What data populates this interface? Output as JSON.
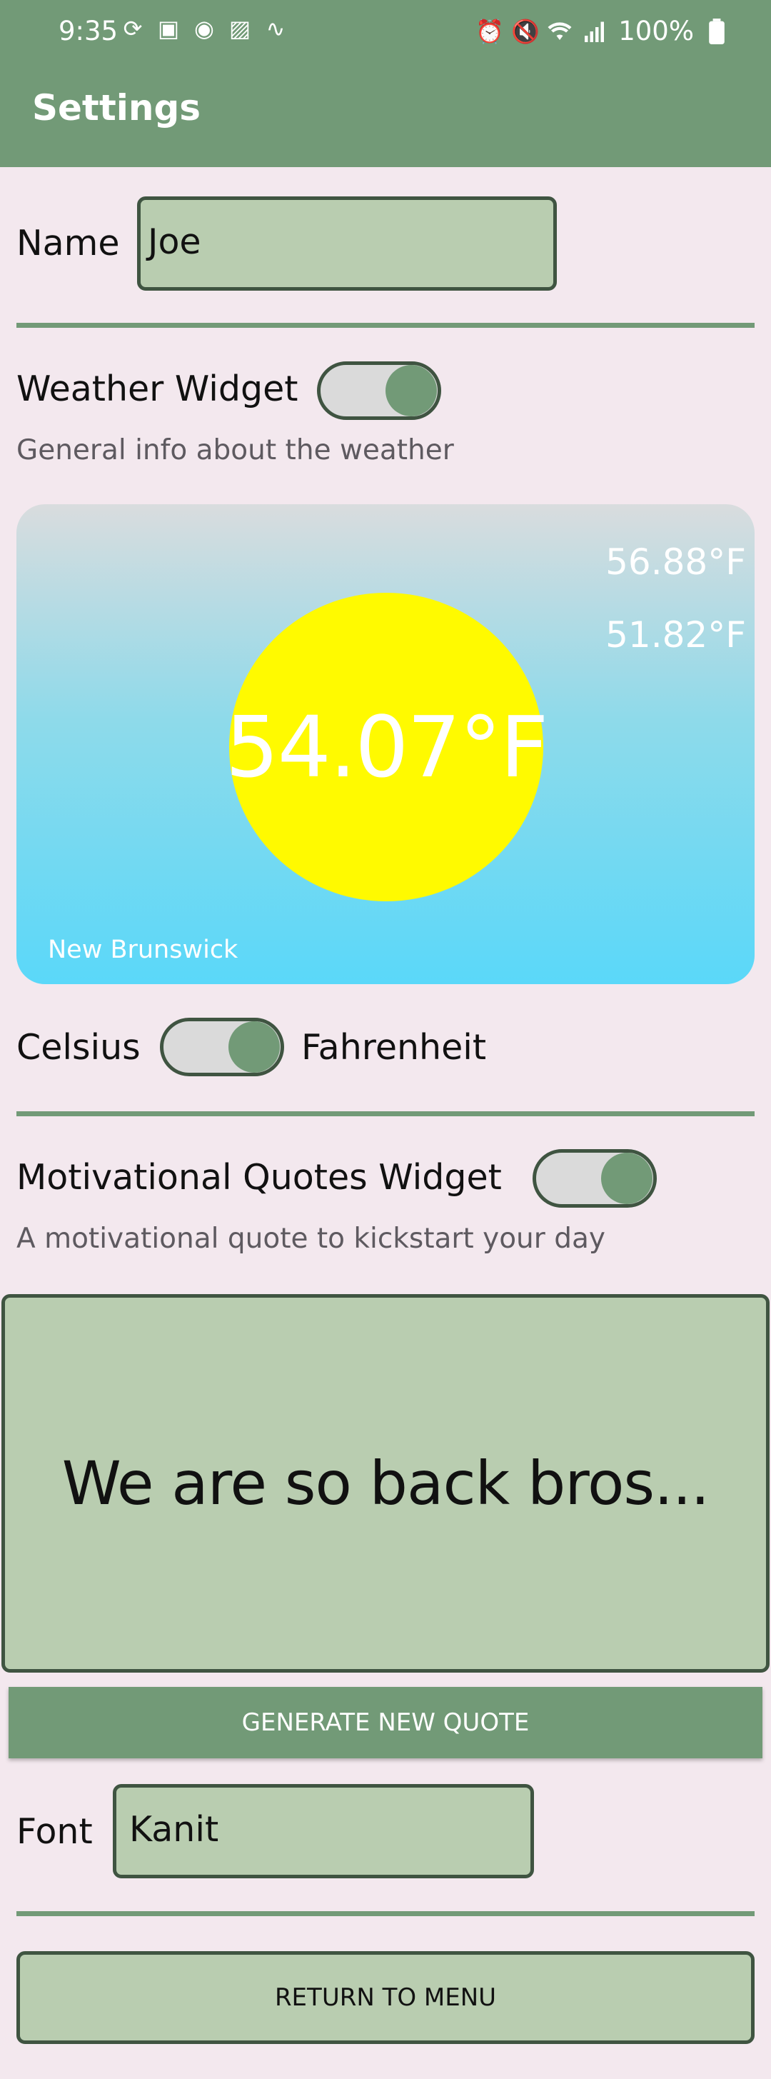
{
  "status_bar": {
    "time": "9:35",
    "battery": "100%",
    "left_icons": [
      "sync-icon",
      "voicemail-icon",
      "assistant-icon",
      "gallery-icon",
      "audio-wave-icon"
    ],
    "right_icons": [
      "alarm-icon",
      "mute-icon",
      "wifi-icon",
      "signal-icon",
      "battery-icon"
    ]
  },
  "appbar": {
    "title": "Settings"
  },
  "name_setting": {
    "label": "Name",
    "value": "Joe"
  },
  "weather_widget": {
    "label": "Weather Widget",
    "description": "General info about the weather",
    "enabled": true,
    "current_temp": "54.07°F",
    "high_temp": "56.88°F",
    "low_temp": "51.82°F",
    "location": "New Brunswick"
  },
  "unit_toggle": {
    "left_label": "Celsius",
    "right_label": "Fahrenheit",
    "fahrenheit_selected": true
  },
  "quotes_widget": {
    "label": "Motivational Quotes Widget",
    "description": "A motivational quote to kickstart your day",
    "enabled": true,
    "quote": "We are so back bros...",
    "button_label": "GENERATE NEW QUOTE"
  },
  "font_setting": {
    "label": "Font",
    "value": "Kanit"
  },
  "return_button": {
    "label": "RETURN TO MENU"
  },
  "colors": {
    "primary": "#729a77",
    "field_bg": "#b9cdb0",
    "border": "#3f5441",
    "background": "#f3e8ee",
    "sun": "#fffa00",
    "sky_bottom": "#5ad8f9"
  }
}
